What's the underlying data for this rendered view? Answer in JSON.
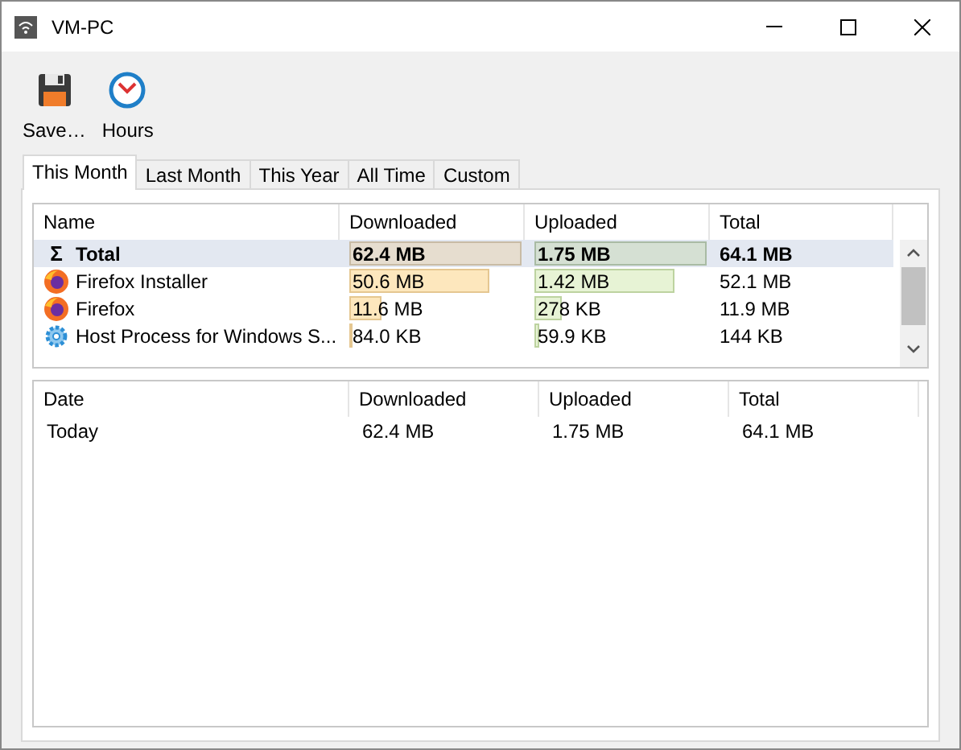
{
  "window": {
    "title": "VM-PC"
  },
  "toolbar": [
    {
      "label": "Save…"
    },
    {
      "label": "Hours"
    }
  ],
  "tabs": [
    {
      "label": "This Month",
      "selected": true
    },
    {
      "label": "Last Month",
      "selected": false
    },
    {
      "label": "This Year",
      "selected": false
    },
    {
      "label": "All Time",
      "selected": false
    },
    {
      "label": "Custom",
      "selected": false
    }
  ],
  "usage_table": {
    "columns": [
      "Name",
      "Downloaded",
      "Uploaded",
      "Total"
    ],
    "rows": [
      {
        "kind": "sum",
        "symbol": "Σ",
        "name": "Total",
        "downloaded": {
          "text": "62.4 MB",
          "level": 1
        },
        "uploaded": {
          "text": "1.75 MB",
          "level": 1
        },
        "total": "64.1 MB",
        "selected": true
      },
      {
        "kind": "firefox",
        "name": "Firefox Installer",
        "downloaded": {
          "text": "50.6 MB",
          "level": 0.81
        },
        "uploaded": {
          "text": "1.42 MB",
          "level": 0.81
        },
        "total": "52.1 MB",
        "selected": false
      },
      {
        "kind": "firefox",
        "name": "Firefox",
        "downloaded": {
          "text": "11.6 MB",
          "level": 0.19
        },
        "uploaded": {
          "text": "278 KB",
          "level": 0.16
        },
        "total": "11.9 MB",
        "selected": false
      },
      {
        "kind": "system",
        "name": "Host Process for Windows S...",
        "downloaded": {
          "text": "84.0 KB",
          "level": 0.01
        },
        "uploaded": {
          "text": "59.9 KB",
          "level": 0.03
        },
        "total": "144 KB",
        "selected": false
      }
    ]
  },
  "history_table": {
    "columns": [
      "Date",
      "Downloaded",
      "Uploaded",
      "Total"
    ],
    "rows": [
      {
        "date": "Today",
        "downloaded": "62.4 MB",
        "uploaded": "1.75 MB",
        "total": "64.1 MB"
      }
    ]
  }
}
